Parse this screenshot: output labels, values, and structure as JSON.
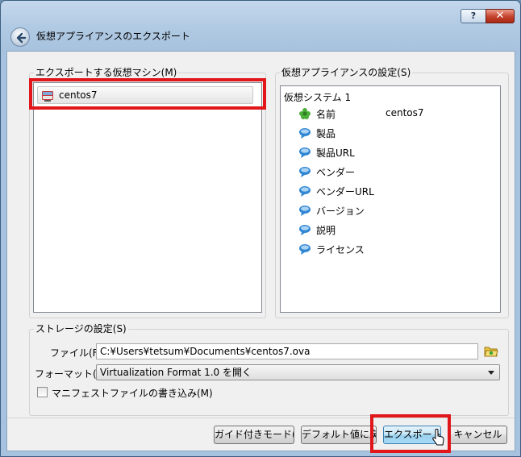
{
  "window": {
    "title": "仮想アプライアンスのエクスポート",
    "help_label": "?",
    "close_label": "✕"
  },
  "vm_group": {
    "title": "エクスポートする仮想マシン(M)",
    "items": [
      {
        "label": "centos7",
        "icon": "virtualbox-vm-icon"
      }
    ]
  },
  "appliance_group": {
    "title": "仮想アプライアンスの設定(S)",
    "root_label": "仮想システム 1",
    "properties": [
      {
        "label": "名前",
        "value": "centos7",
        "icon": "green-star-icon"
      },
      {
        "label": "製品",
        "value": "",
        "icon": "speech-bubble-icon"
      },
      {
        "label": "製品URL",
        "value": "",
        "icon": "speech-bubble-icon"
      },
      {
        "label": "ベンダー",
        "value": "",
        "icon": "speech-bubble-icon"
      },
      {
        "label": "ベンダーURL",
        "value": "",
        "icon": "speech-bubble-icon"
      },
      {
        "label": "バージョン",
        "value": "",
        "icon": "speech-bubble-icon"
      },
      {
        "label": "説明",
        "value": "",
        "icon": "speech-bubble-icon"
      },
      {
        "label": "ライセンス",
        "value": "",
        "icon": "speech-bubble-icon"
      }
    ]
  },
  "storage_group": {
    "title": "ストレージの設定(S)",
    "file_label": "ファイル(F):",
    "file_value": "C:¥Users¥tetsum¥Documents¥centos7.ova",
    "format_label": "フォーマット(O):",
    "format_value": "Virtualization Format 1.0 を開く",
    "manifest_label": "マニフェストファイルの書き込み(M)",
    "manifest_checked": false
  },
  "buttons": {
    "guided": "ガイド付きモード(G)",
    "restore": "デフォルト値に戻す",
    "export": "エクスポート",
    "cancel": "キャンセル"
  },
  "colors": {
    "highlight": "#e1161b",
    "accent": "#3c7fb1"
  }
}
